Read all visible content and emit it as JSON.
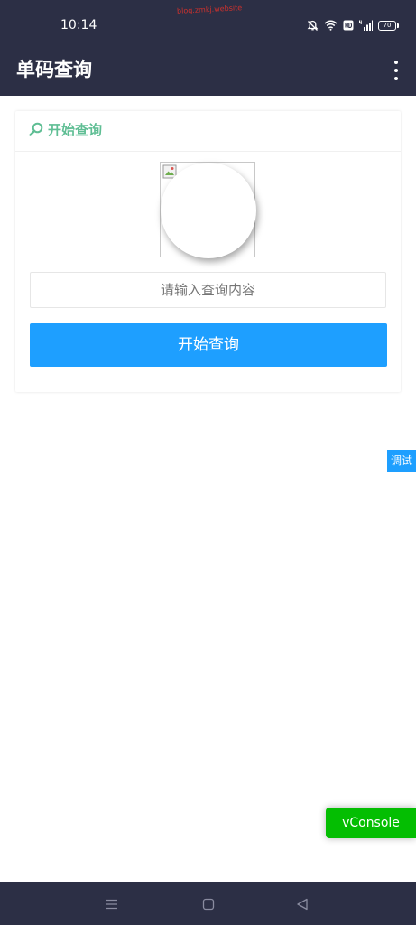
{
  "status_bar": {
    "time": "10:14",
    "watermark": "blog.zmkj.website",
    "battery": "70"
  },
  "header": {
    "title": "单码查询"
  },
  "card": {
    "title": "开始查询",
    "input_placeholder": "请输入查询内容",
    "input_value": "",
    "button_label": "开始查询"
  },
  "debug_tag": "调试",
  "vconsole_label": "vConsole",
  "colors": {
    "bar_background": "#2c2f45",
    "accent_green": "#5fbe94",
    "primary_blue": "#1e9fff",
    "vconsole_green": "#04be02"
  },
  "icons": [
    "mute-bell-icon",
    "wifi-icon",
    "hd-icon",
    "signal-icon",
    "battery-icon",
    "more-vertical-icon",
    "search-icon",
    "broken-image-icon",
    "menu-icon",
    "home-icon",
    "back-icon"
  ]
}
